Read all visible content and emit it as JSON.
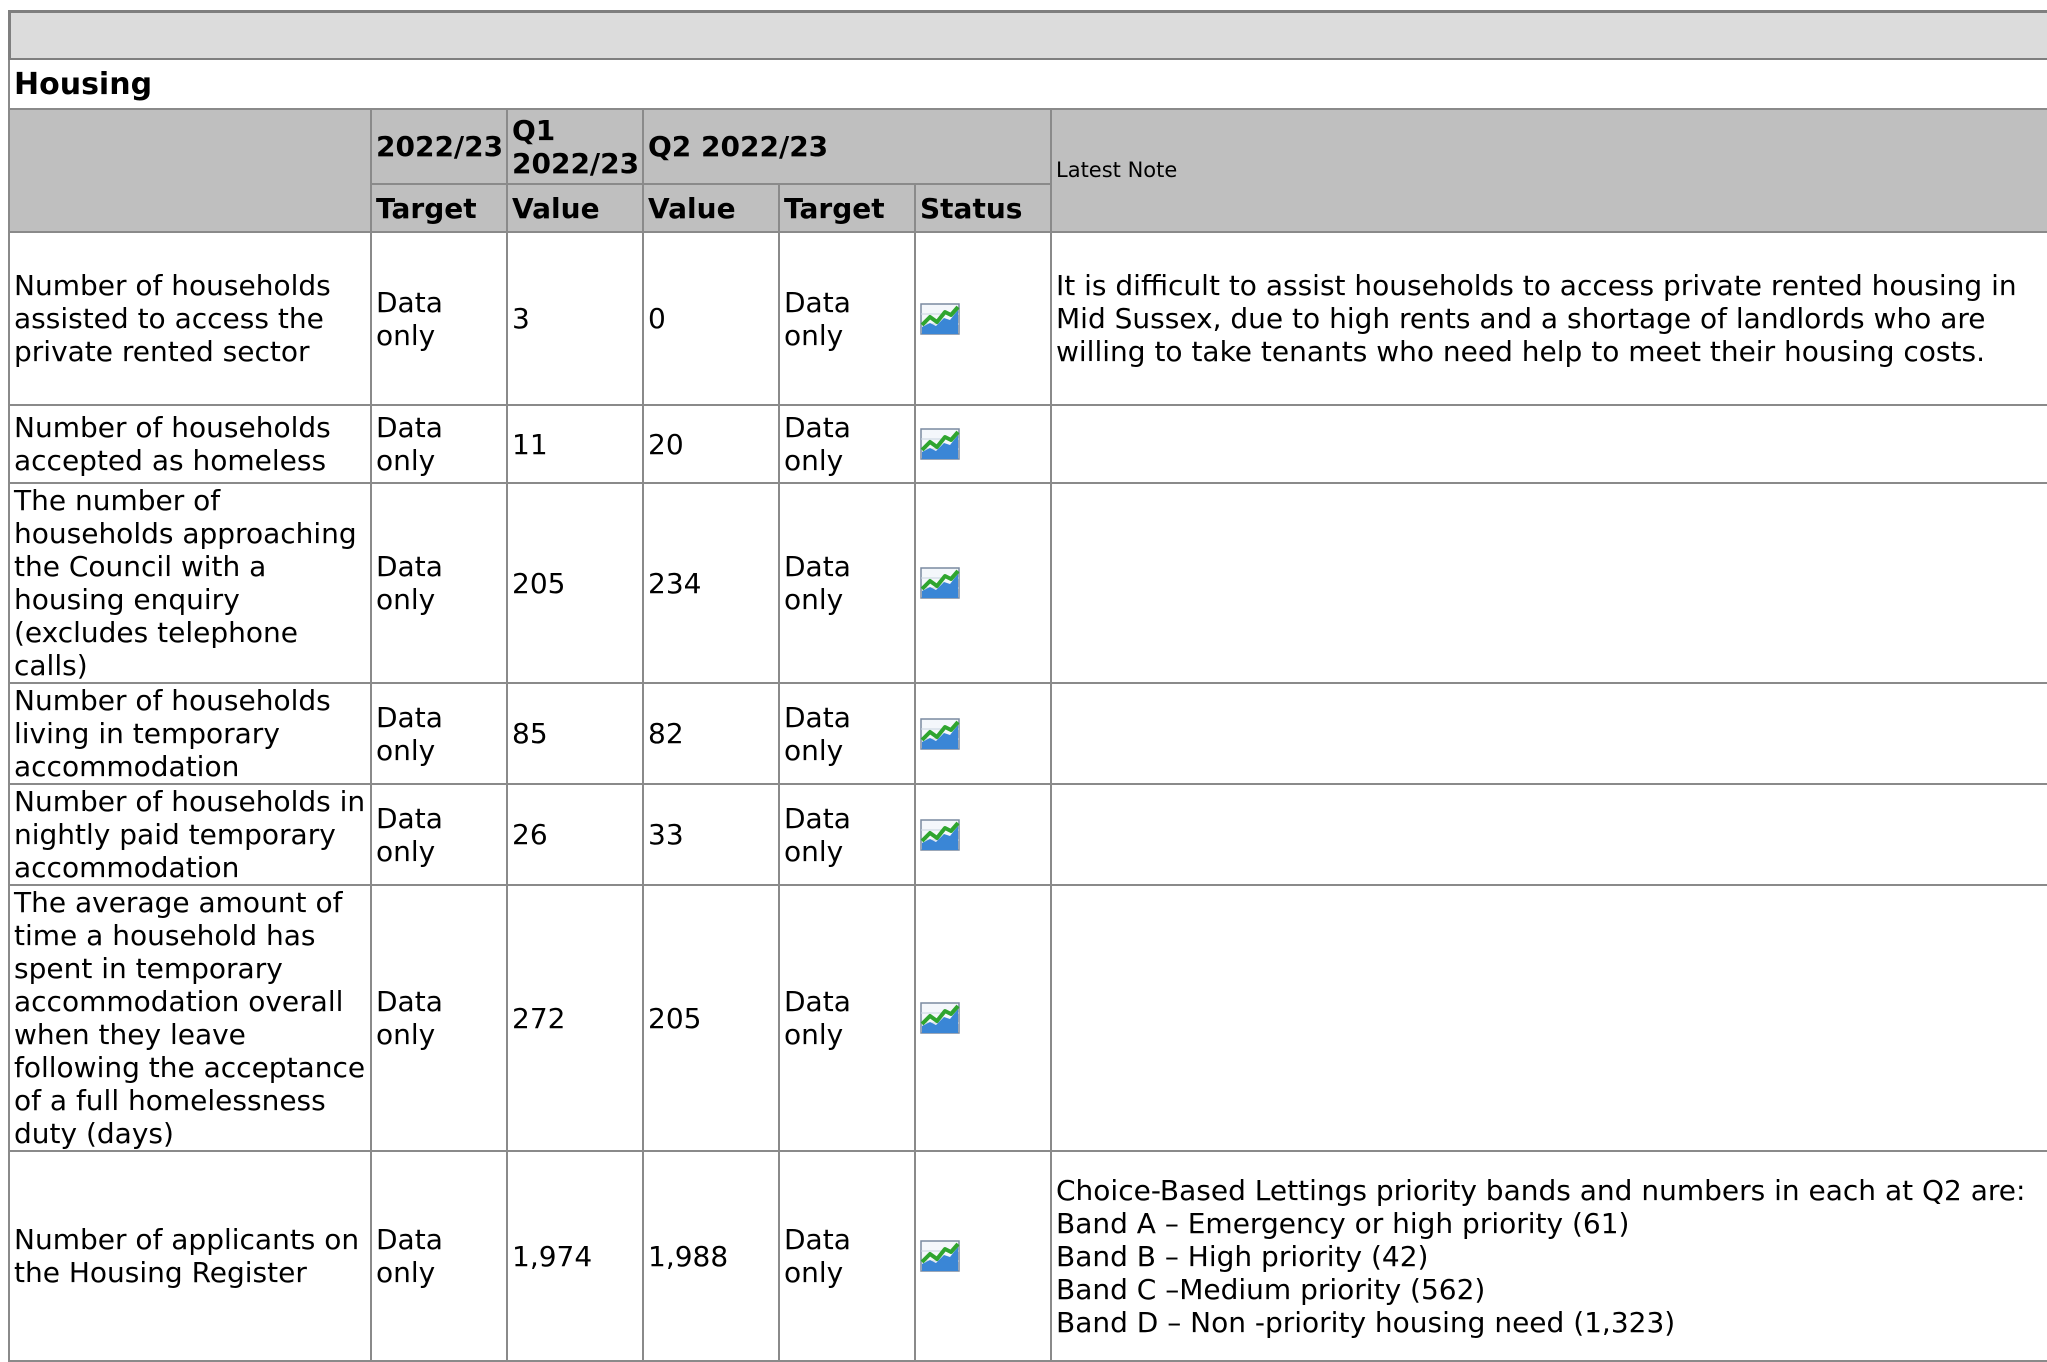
{
  "section_title": "Housing",
  "headers": {
    "row1": [
      "",
      "2022/23",
      "Q1 2022/23",
      "Q2 2022/23",
      "Latest Note"
    ],
    "row2": [
      "Target",
      "Value",
      "Value",
      "Target",
      "Status"
    ]
  },
  "rows": [
    {
      "name": "Number of households assisted to access the private rented sector",
      "target_2022_23": "Data only",
      "q1_value": "3",
      "q2_value": "0",
      "q2_target": "Data only",
      "status_icon": "trend-chart-icon",
      "note": [
        "It is difficult to assist households to access private rented housing in Mid Sussex, due to high rents and a shortage of landlords who are willing to take tenants who need help to meet their housing costs."
      ]
    },
    {
      "name": "Number of households accepted as homeless",
      "target_2022_23": "Data only",
      "q1_value": "11",
      "q2_value": "20",
      "q2_target": "Data only",
      "status_icon": "trend-chart-icon",
      "note": []
    },
    {
      "name": "The number of households approaching the Council with a housing enquiry (excludes telephone calls)",
      "target_2022_23": "Data only",
      "q1_value": "205",
      "q2_value": "234",
      "q2_target": "Data only",
      "status_icon": "trend-chart-icon",
      "note": []
    },
    {
      "name": "Number of households living in temporary accommodation",
      "target_2022_23": "Data only",
      "q1_value": "85",
      "q2_value": "82",
      "q2_target": "Data only",
      "status_icon": "trend-chart-icon",
      "note": []
    },
    {
      "name": "Number of households in nightly paid temporary accommodation",
      "target_2022_23": "Data only",
      "q1_value": "26",
      "q2_value": "33",
      "q2_target": "Data only",
      "status_icon": "trend-chart-icon",
      "note": []
    },
    {
      "name": "The average amount of time a household has spent in temporary accommodation overall when they leave following the acceptance of a full homelessness duty (days)",
      "target_2022_23": "Data only",
      "q1_value": "272",
      "q2_value": "205",
      "q2_target": "Data only",
      "status_icon": "trend-chart-icon",
      "note": []
    },
    {
      "name": "Number of applicants on the Housing Register",
      "target_2022_23": "Data only",
      "q1_value": "1,974",
      "q2_value": "1,988",
      "q2_target": "Data only",
      "status_icon": "trend-chart-icon",
      "note": [
        "Choice-Based Lettings priority bands and numbers in each at Q2 are:",
        "Band A – Emergency or high priority (61)",
        "Band B – High priority (42)",
        "Band C –Medium priority (562)",
        "Band D – Non -priority housing need (1,323)"
      ]
    }
  ]
}
